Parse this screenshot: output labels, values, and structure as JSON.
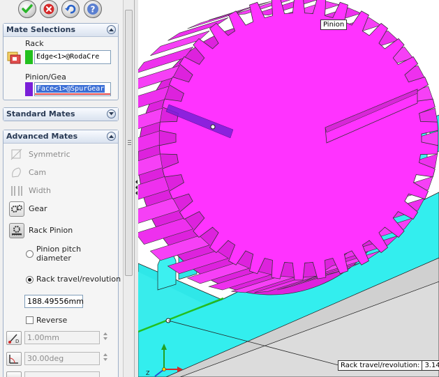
{
  "toolbar": {
    "ok_icon": "checkmark-icon",
    "cancel_icon": "x-icon",
    "undo_icon": "undo-icon",
    "help_icon": "help-icon"
  },
  "mate_selections": {
    "title": "Mate Selections",
    "rack_label": "Rack",
    "rack_value": "Edge<1>@RodaCre",
    "pinion_label": "Pinion/Gea",
    "pinion_value": "Face<1>@SpurGear",
    "rack_color": "#22c01e",
    "pinion_color": "#7a1fd8"
  },
  "standard_mates": {
    "title": "Standard Mates"
  },
  "advanced_mates": {
    "title": "Advanced Mates",
    "items": [
      {
        "label": "Symmetric",
        "icon": "symmetric-icon",
        "enabled": false
      },
      {
        "label": "Cam",
        "icon": "cam-icon",
        "enabled": false
      },
      {
        "label": "Width",
        "icon": "width-icon",
        "enabled": false
      },
      {
        "label": "Gear",
        "icon": "gear-icon",
        "enabled": true
      },
      {
        "label": "Rack Pinion",
        "icon": "rack-pinion-icon",
        "enabled": true,
        "selected": true
      }
    ],
    "option_pitch_line1": "Pinion pitch",
    "option_pitch_line2": "diameter",
    "option_travel": "Rack travel/revolution",
    "travel_value": "188.49556mm",
    "reverse_label": "Reverse",
    "distance_value": "1.00mm",
    "angle_value": "30.00deg"
  },
  "viewport": {
    "pinion_tag": "Pinion",
    "callout_label": "Rack travel/revolution:",
    "callout_value": "3.14",
    "gear_color": "#ff33ff",
    "rack_color": "#33ffff",
    "triad_label": "Z"
  }
}
